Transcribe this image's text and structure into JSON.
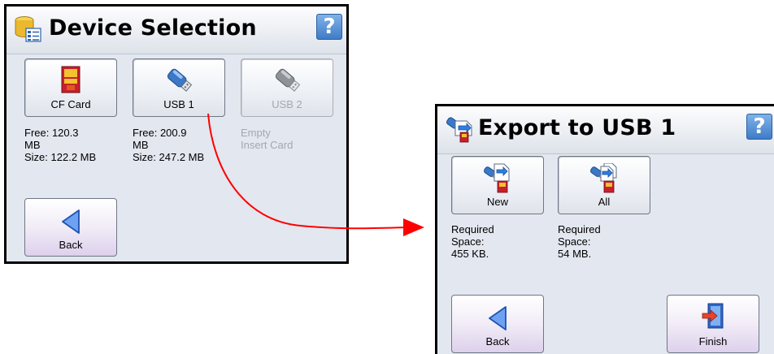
{
  "device_selection": {
    "title": "Device Selection",
    "help_label": "?",
    "devices": [
      {
        "label": "CF Card",
        "info": [
          "Free: 120.3",
          "MB",
          "Size: 122.2 MB"
        ]
      },
      {
        "label": "USB 1",
        "info": [
          "Free: 200.9",
          "MB",
          "Size: 247.2 MB"
        ]
      },
      {
        "label": "USB 2",
        "info": [
          "Empty",
          "Insert Card"
        ]
      }
    ],
    "back_label": "Back"
  },
  "export": {
    "title": "Export to USB 1",
    "help_label": "?",
    "options": [
      {
        "label": "New",
        "info": [
          "Required",
          "Space:",
          "455 KB."
        ]
      },
      {
        "label": "All",
        "info": [
          "Required",
          "Space:",
          "54 MB."
        ]
      }
    ],
    "back_label": "Back",
    "finish_label": "Finish"
  },
  "colors": {
    "arrow": "#ff0000",
    "help": "#3f7cc8",
    "panel": "#e3e7ef"
  }
}
